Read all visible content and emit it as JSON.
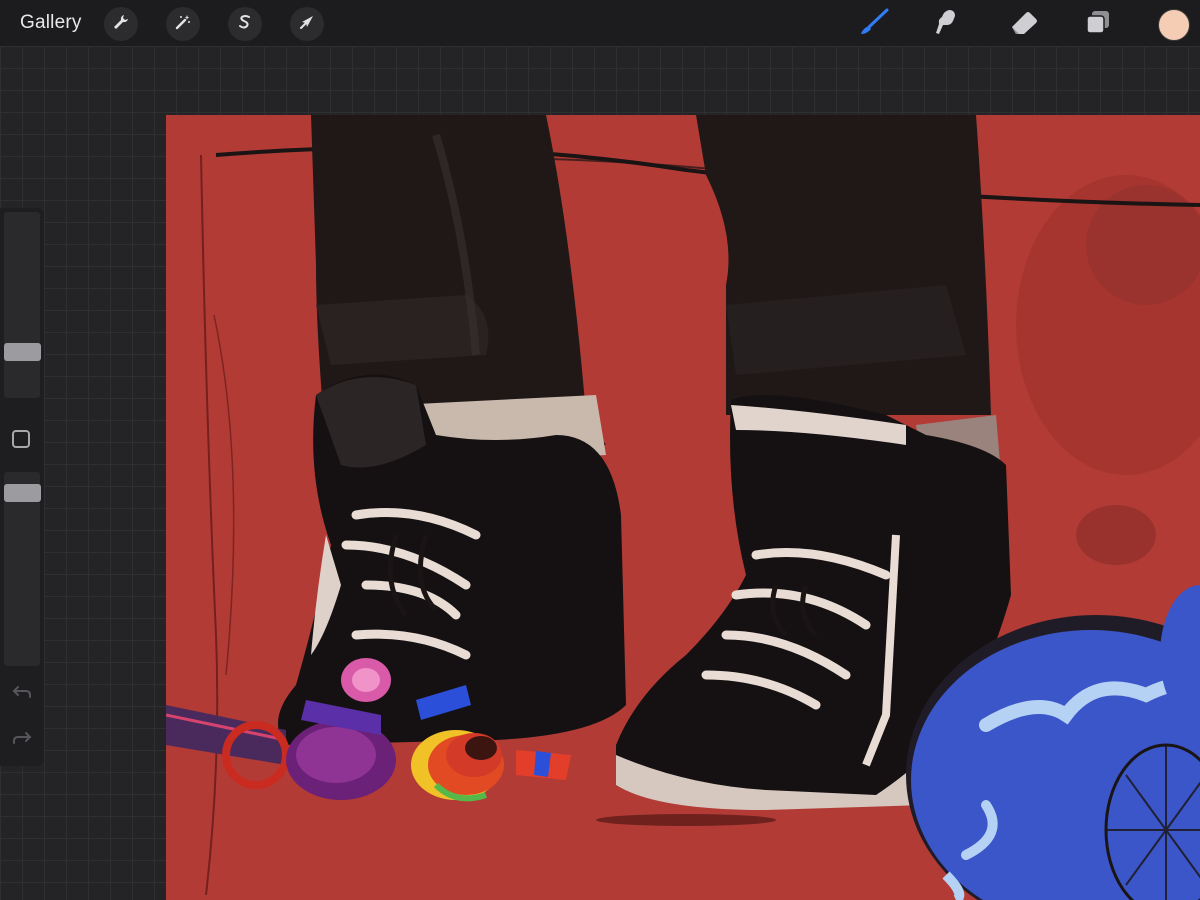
{
  "toolbar": {
    "gallery_label": "Gallery",
    "left_tools": [
      {
        "name": "actions",
        "icon": "wrench-icon"
      },
      {
        "name": "adjustments",
        "icon": "magic-wand-icon"
      },
      {
        "name": "selection",
        "icon": "selection-s-icon"
      },
      {
        "name": "transform",
        "icon": "arrow-cursor-icon"
      }
    ],
    "right_tools": [
      {
        "name": "brush",
        "icon": "brush-icon",
        "active": true,
        "color": "#2f7cf6"
      },
      {
        "name": "smudge",
        "icon": "smudge-finger-icon",
        "active": false
      },
      {
        "name": "eraser",
        "icon": "eraser-icon",
        "active": false
      },
      {
        "name": "layers",
        "icon": "layers-icon",
        "active": false
      }
    ],
    "current_color": "#f5cdb4"
  },
  "sidebar": {
    "brush_size_level": 0.22,
    "opacity_level": 0.93,
    "modify_button_icon": "square-icon",
    "undo_icon": "undo-arrow-icon",
    "redo_icon": "redo-arrow-icon"
  },
  "canvas": {
    "background_color": "#b33b36",
    "artwork": "sneakers-with-party-streamers-and-blue-balloons"
  }
}
